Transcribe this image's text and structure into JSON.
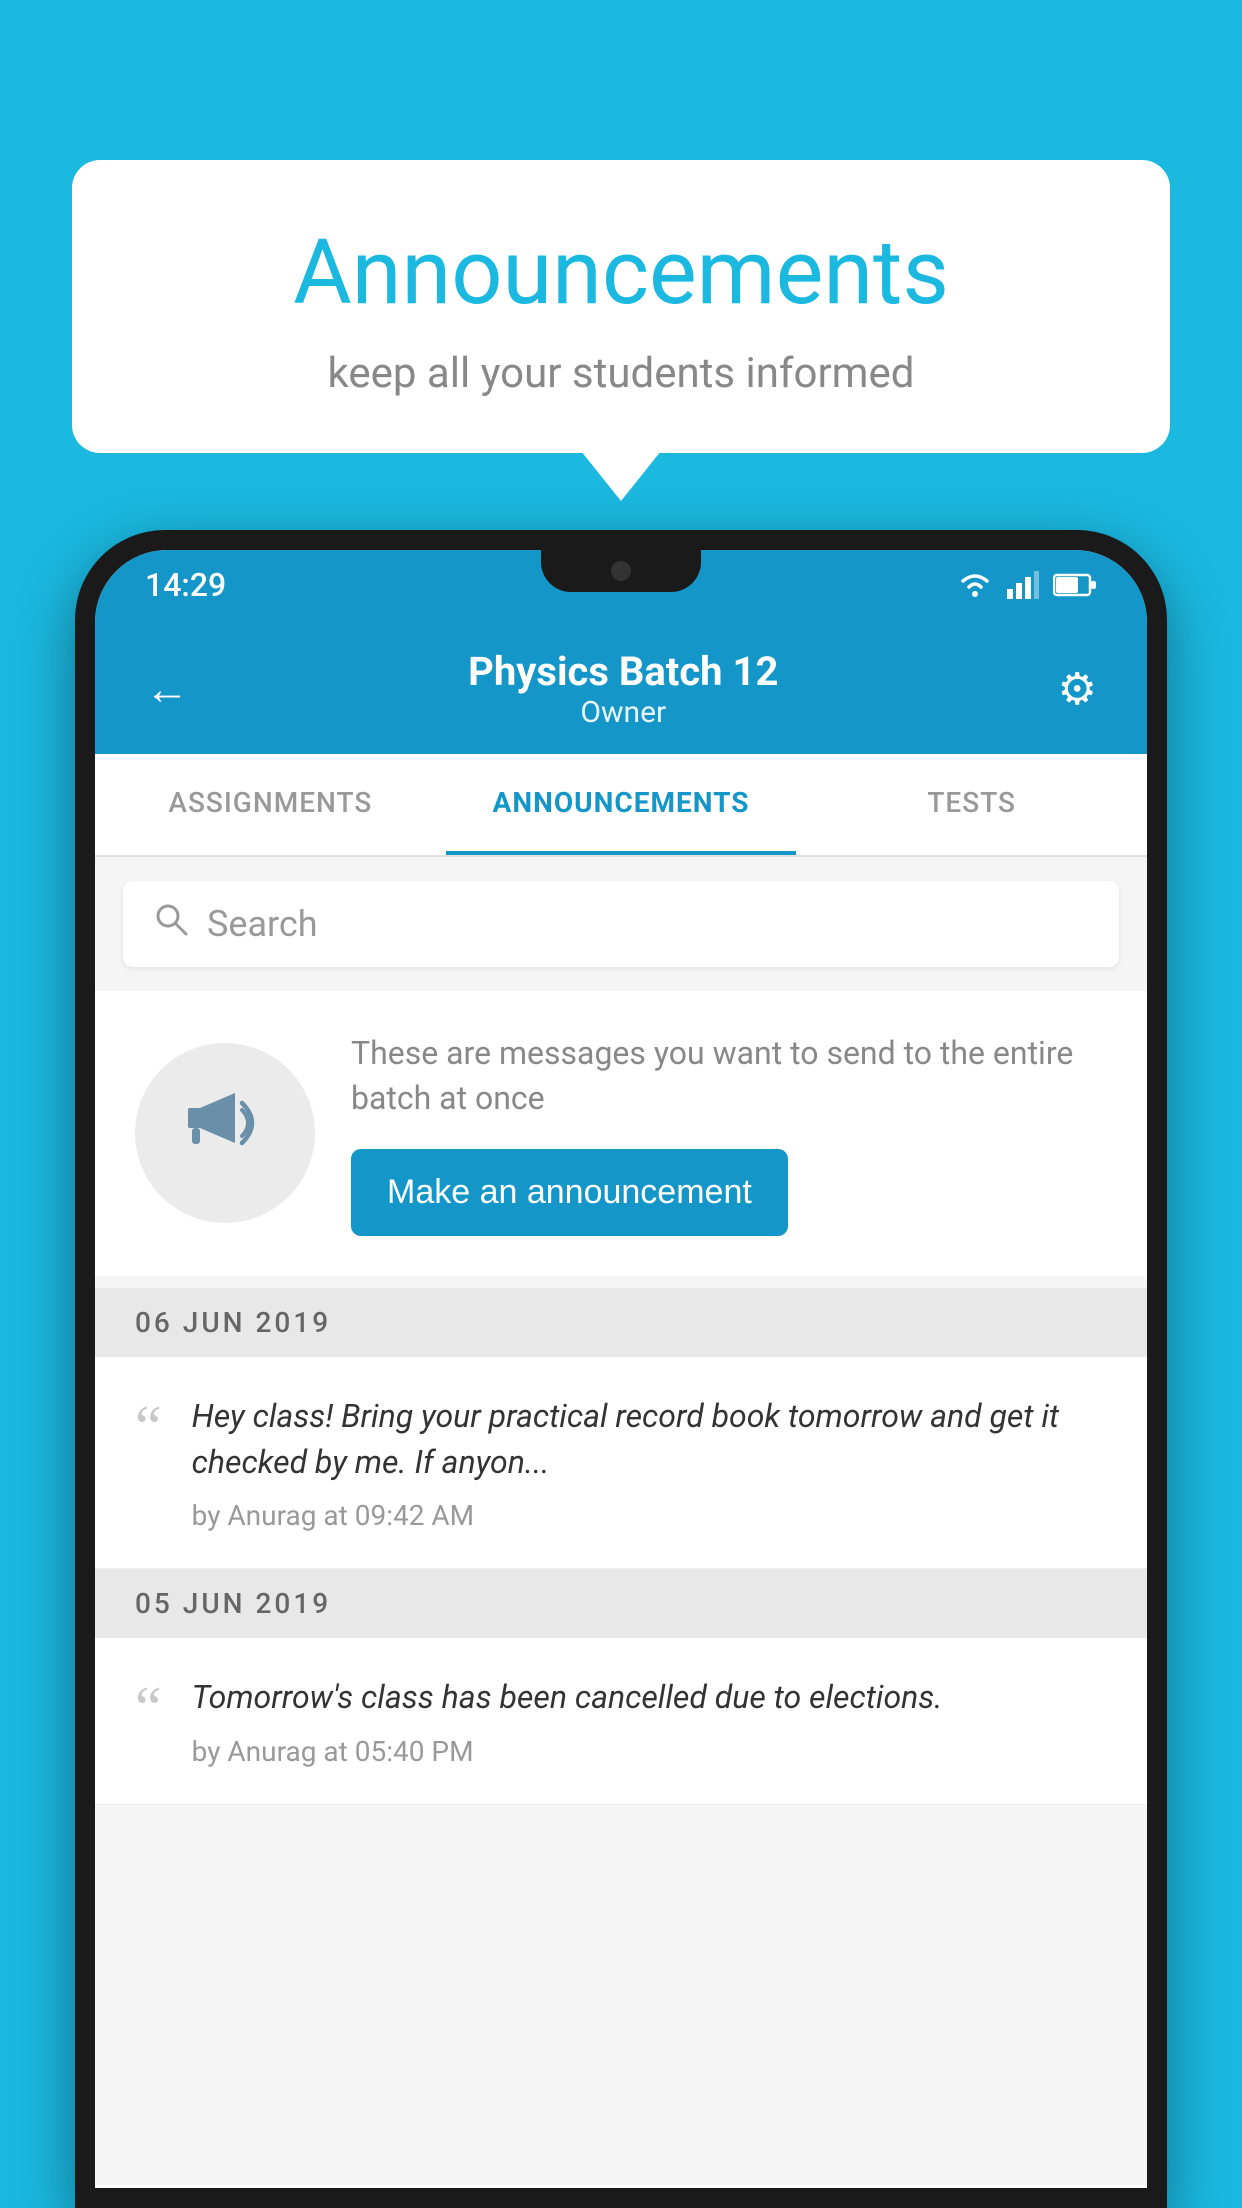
{
  "background": {
    "color": "#1bb8e0"
  },
  "speech_bubble": {
    "title": "Announcements",
    "subtitle": "keep all your students informed"
  },
  "status_bar": {
    "time": "14:29"
  },
  "header": {
    "title": "Physics Batch 12",
    "subtitle": "Owner",
    "back_label": "←"
  },
  "tabs": [
    {
      "label": "ASSIGNMENTS",
      "active": false
    },
    {
      "label": "ANNOUNCEMENTS",
      "active": true
    },
    {
      "label": "TESTS",
      "active": false
    }
  ],
  "search": {
    "placeholder": "Search"
  },
  "announcement_prompt": {
    "description": "These are messages you want to send to the entire batch at once",
    "button_label": "Make an announcement"
  },
  "date_groups": [
    {
      "date": "06  JUN  2019",
      "items": [
        {
          "text": "Hey class! Bring your practical record book tomorrow and get it checked by me. If anyon...",
          "meta": "by Anurag at 09:42 AM"
        }
      ]
    },
    {
      "date": "05  JUN  2019",
      "items": [
        {
          "text": "Tomorrow's class has been cancelled due to elections.",
          "meta": "by Anurag at 05:40 PM"
        }
      ]
    }
  ]
}
